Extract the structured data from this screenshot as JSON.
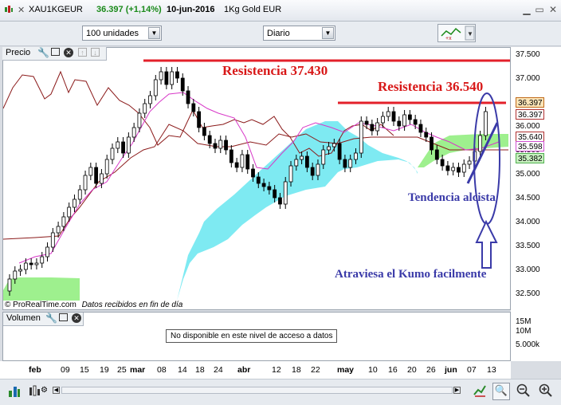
{
  "header": {
    "symbol": "XAU1KGEUR",
    "price_change": "36.397 (+1,14%)",
    "date": "10-jun-2016",
    "instrument_name": "1Kg Gold EUR"
  },
  "toolbar": {
    "units_select": "100 unidades",
    "period_select": "Diario"
  },
  "price_panel": {
    "label": "Precio",
    "watermark_brand": "© ProRealTime.com",
    "watermark_note": "Datos recibidos en fin de día"
  },
  "volume_panel": {
    "label": "Volumen",
    "notice": "No disponible en este nivel de acceso a datos",
    "axis_ticks": [
      "15M",
      "10M",
      "5.000k"
    ]
  },
  "y_axis_ticks": [
    "37.500",
    "37.000",
    "36.500",
    "36.000",
    "35.500",
    "35.000",
    "34.500",
    "34.000",
    "33.500",
    "33.000",
    "32.500"
  ],
  "price_labels": [
    {
      "text": "36.397",
      "color": "#fbe5b8",
      "border": "#c06a1a"
    },
    {
      "text": "36.397",
      "color": "#ffffff",
      "border": "#b03030"
    },
    {
      "text": "35.640",
      "color": "#ffffff",
      "border": "#b03030"
    },
    {
      "text": "35.598",
      "color": "#ffffff",
      "border": "#d050d0"
    },
    {
      "text": "35.382",
      "color": "#c8f0c0",
      "border": "#50b050"
    }
  ],
  "x_axis_labels": [
    "feb",
    "09",
    "15",
    "19",
    "25",
    "mar",
    "08",
    "14",
    "18",
    "24",
    "abr",
    "12",
    "18",
    "22",
    "may",
    "10",
    "16",
    "20",
    "26",
    "jun",
    "07",
    "13"
  ],
  "annotations": {
    "resistance_1": "Resistencia  37.430",
    "resistance_2": "Resistencia  36.540",
    "trend": "Tendencia alcista",
    "kumo": "Atraviesa el Kumo facilmente"
  },
  "colors": {
    "resistance_line": "#e3202a",
    "annotation_red": "#d81818",
    "annotation_blue": "#3a3aa8",
    "kumo_cyan": "#7eeaf2",
    "kumo_green": "#9ef08e",
    "tenkan": "#d838c8",
    "kijun": "#8b1a1a",
    "chikou": "#8b1a1a",
    "candle_up": "#ffffff",
    "candle_down": "#000000"
  }
}
